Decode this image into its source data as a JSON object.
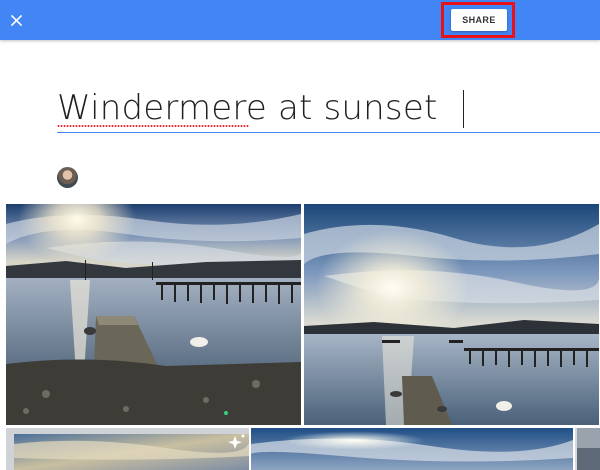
{
  "toolbar": {
    "close_icon": "close-icon",
    "share_label": "SHARE",
    "share_highlight_color": "#e8121a",
    "bar_color": "#4285f4"
  },
  "album": {
    "title": "Windermere at sunset",
    "avatar_icon": "user-avatar"
  },
  "photos": [
    {
      "name": "photo-jetty-sunset-1",
      "alt": "Jetty at sunset with swans"
    },
    {
      "name": "photo-lake-sunset-2",
      "alt": "Lake at sunset with jetty"
    },
    {
      "name": "photo-sky-3",
      "alt": "Sunset sky with sparkle"
    },
    {
      "name": "photo-sky-4",
      "alt": "Sunset sky"
    },
    {
      "name": "photo-edge-5",
      "alt": "Partially visible photo"
    }
  ]
}
